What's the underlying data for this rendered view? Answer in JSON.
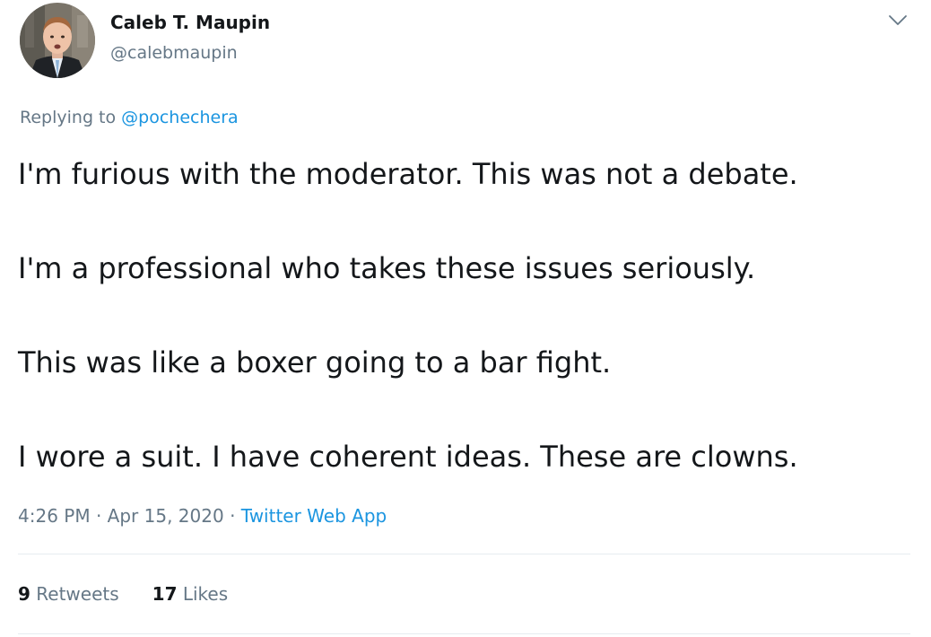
{
  "author": {
    "display_name": "Caleb T. Maupin",
    "handle": "@calebmaupin",
    "avatar_icon": "profile-photo"
  },
  "reply": {
    "prefix": "Replying to",
    "target": "@pochechera"
  },
  "tweet": {
    "paragraphs": [
      "I'm furious with the moderator. This was not a debate.",
      "I'm a professional who takes these issues seriously.",
      "This was like a boxer going to a bar fight.",
      "I wore a suit. I have coherent ideas. These are clowns."
    ]
  },
  "meta": {
    "time": "4:26 PM",
    "separator": "·",
    "date": "Apr 15, 2020",
    "source": "Twitter Web App"
  },
  "stats": {
    "retweets_count": "9",
    "retweets_label": "Retweets",
    "likes_count": "17",
    "likes_label": "Likes"
  },
  "menu": {
    "icon": "chevron-down-icon"
  },
  "colors": {
    "text": "#14171a",
    "secondary": "#657786",
    "link": "#1b95e0",
    "divider": "#e6ecf0"
  }
}
